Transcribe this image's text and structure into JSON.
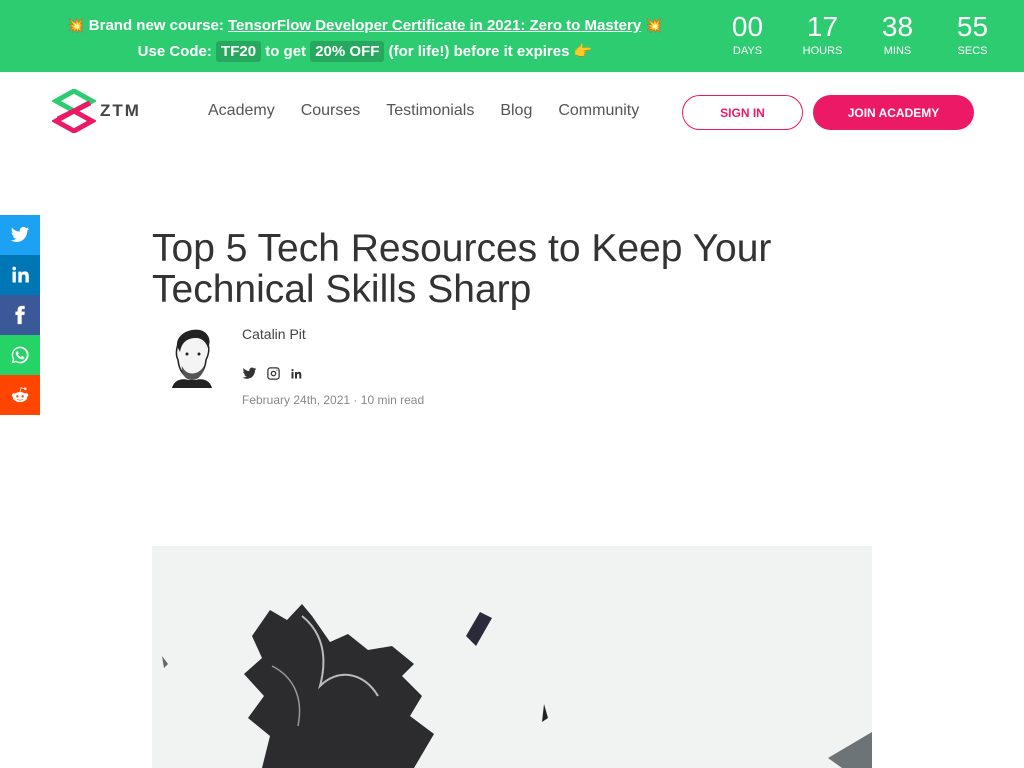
{
  "promo": {
    "emoji_left": "💥",
    "lead": "Brand new course:",
    "course_link": "TensorFlow Developer Certificate in 2021: Zero to Mastery",
    "emoji_right": "💥",
    "use_code": "Use Code:",
    "code": "TF20",
    "to_get": "to get",
    "discount": "20% OFF",
    "tail": "(for life!) before it expires",
    "emoji_hand": "👉",
    "countdown": [
      {
        "value": "00",
        "label": "DAYS"
      },
      {
        "value": "17",
        "label": "HOURS"
      },
      {
        "value": "38",
        "label": "MINS"
      },
      {
        "value": "55",
        "label": "SECS"
      }
    ]
  },
  "header": {
    "logo_text": "ZTM",
    "nav": [
      "Academy",
      "Courses",
      "Testimonials",
      "Blog",
      "Community"
    ],
    "sign_in": "SIGN IN",
    "join": "JOIN ACADEMY"
  },
  "share": {
    "items": [
      {
        "icon": "twitter-icon",
        "color": "#1da1f2"
      },
      {
        "icon": "linkedin-icon",
        "color": "#0077b5"
      },
      {
        "icon": "facebook-icon",
        "color": "#3b5998"
      },
      {
        "icon": "whatsapp-icon",
        "color": "#25d366"
      },
      {
        "icon": "reddit-icon",
        "color": "#ff4500"
      }
    ]
  },
  "article": {
    "title": "Top 5 Tech Resources to Keep Your Technical Skills Sharp",
    "author": "Catalin Pit",
    "author_socials": [
      "twitter-icon",
      "instagram-icon",
      "linkedin-icon"
    ],
    "date": "February 24th, 2021",
    "read_time": "10 min read"
  },
  "colors": {
    "promo_bg": "#2ecc71",
    "brand_pink": "#ec1a66"
  }
}
